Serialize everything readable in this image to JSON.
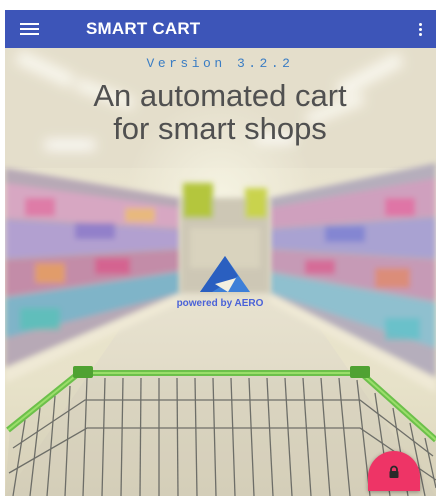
{
  "appbar": {
    "title": "SMART CART",
    "menu_icon": "hamburger-menu-icon",
    "overflow_icon": "more-vert-icon",
    "color": "#3d55b8"
  },
  "splash": {
    "version": "Version 3.2.2",
    "headline_line1": "An automated cart",
    "headline_line2": "for smart shops",
    "powered_by": "powered by AERO",
    "logo_icon": "aero-triangle-logo",
    "version_color": "#3a7dc4",
    "powered_color": "#4a62d8"
  },
  "fab": {
    "icon": "lock-icon",
    "color": "#ee3466"
  }
}
